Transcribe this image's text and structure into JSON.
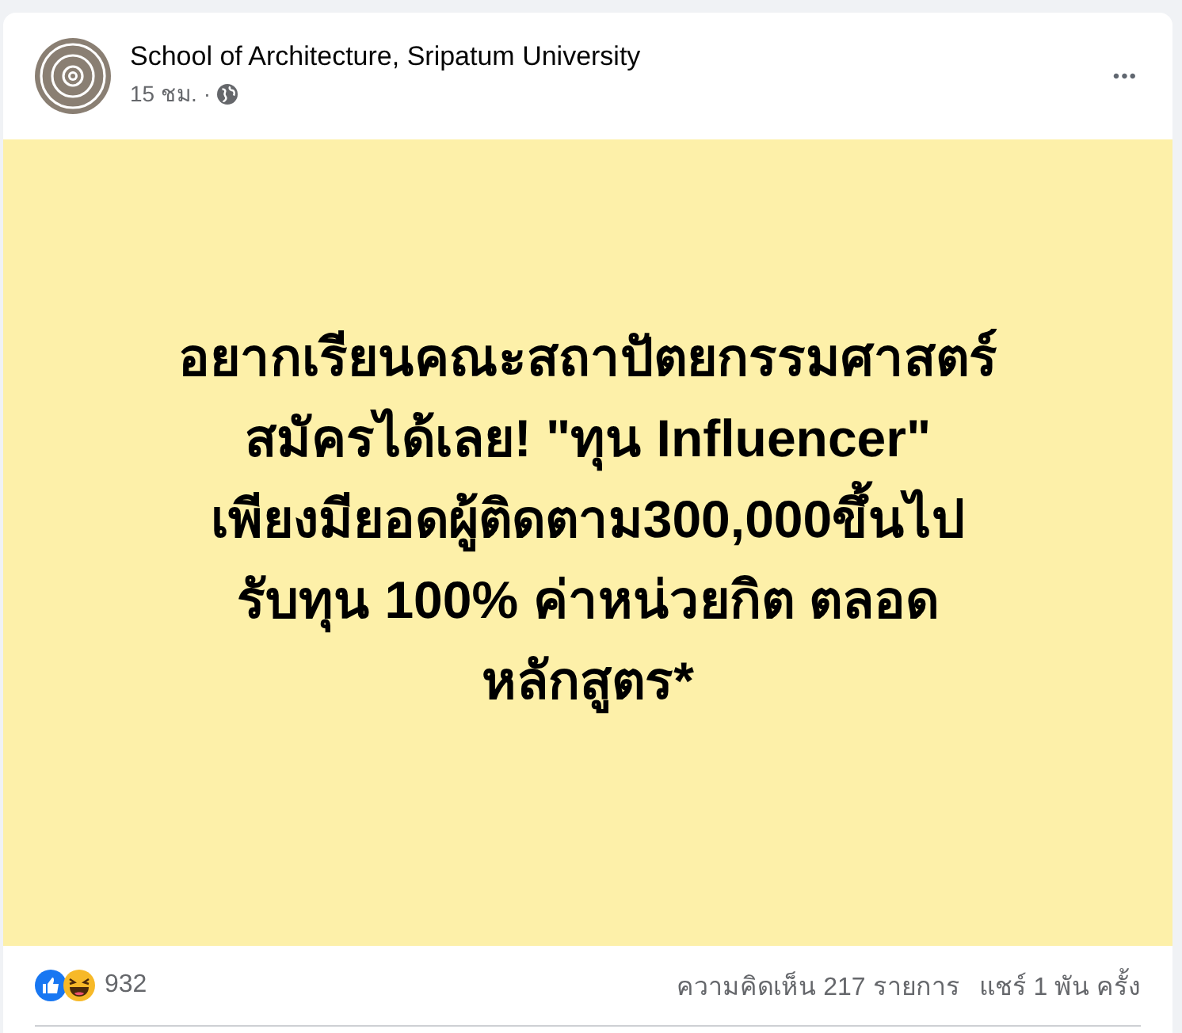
{
  "post": {
    "author": "School of Architecture, Sripatum University",
    "time": "15 ชม.",
    "separator": "·",
    "menu": "•••",
    "text": "อยากเรียนคณะสถาปัตยกรรมศาสตร์\nสมัครได้เลย! \"ทุน Influencer\"\nเพียงมียอดผู้ติดตาม300,000ขึ้นไป\nรับทุน 100% ค่าหน่วยกิต ตลอด\nหลักสูตร*",
    "reactions_count": "932",
    "comments": "ความคิดเห็น 217 รายการ",
    "shares": "แชร์ 1 พัน ครั้ง"
  }
}
